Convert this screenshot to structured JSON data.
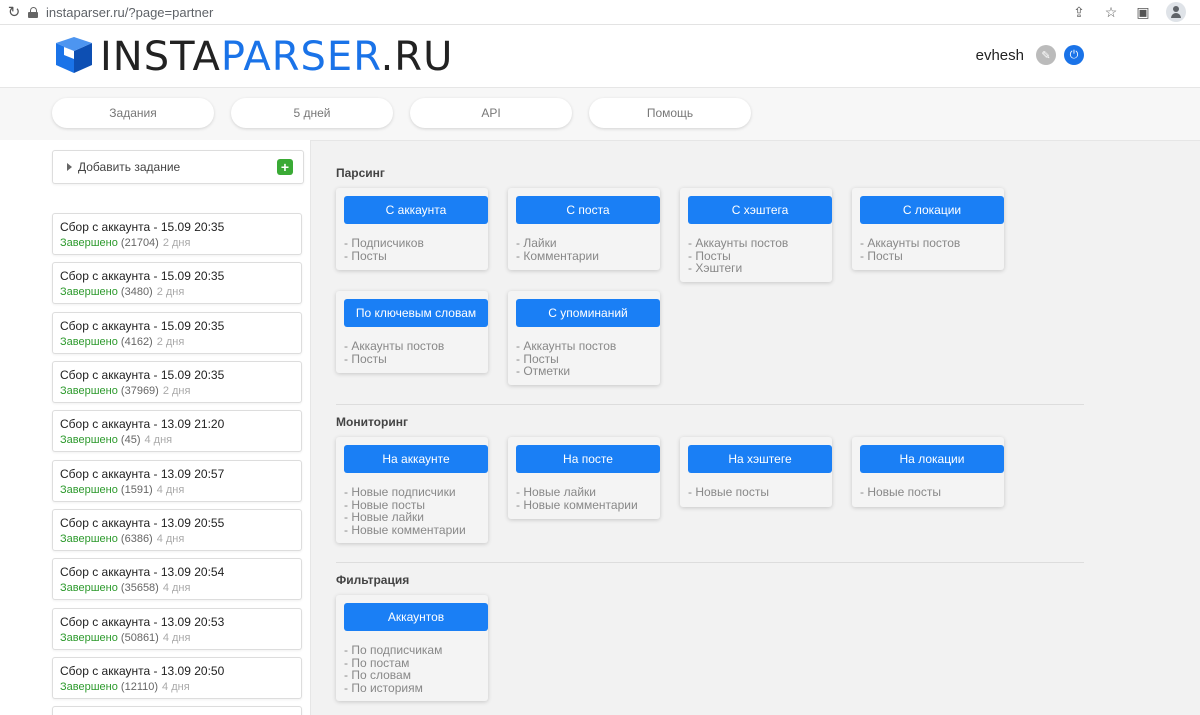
{
  "browser": {
    "url": "instaparser.ru/?page=partner"
  },
  "header": {
    "logo_part1": "INSTA",
    "logo_part2": "PARSER",
    "logo_part3": ".RU",
    "username": "evhesh"
  },
  "nav": {
    "tabs": [
      "Задания",
      "5 дней",
      "API",
      "Помощь"
    ]
  },
  "sidebar": {
    "add_task_label": "Добавить задание",
    "tasks": [
      {
        "title": "Сбор с аккаунта - 15.09 20:35",
        "status": "Завершено",
        "count": "(21704)",
        "age": "2 дня"
      },
      {
        "title": "Сбор с аккаунта - 15.09 20:35",
        "status": "Завершено",
        "count": "(3480)",
        "age": "2 дня"
      },
      {
        "title": "Сбор с аккаунта - 15.09 20:35",
        "status": "Завершено",
        "count": "(4162)",
        "age": "2 дня"
      },
      {
        "title": "Сбор с аккаунта - 15.09 20:35",
        "status": "Завершено",
        "count": "(37969)",
        "age": "2 дня"
      },
      {
        "title": "Сбор с аккаунта - 13.09 21:20",
        "status": "Завершено",
        "count": "(45)",
        "age": "4 дня"
      },
      {
        "title": "Сбор с аккаунта - 13.09 20:57",
        "status": "Завершено",
        "count": "(1591)",
        "age": "4 дня"
      },
      {
        "title": "Сбор с аккаунта - 13.09 20:55",
        "status": "Завершено",
        "count": "(6386)",
        "age": "4 дня"
      },
      {
        "title": "Сбор с аккаунта - 13.09 20:54",
        "status": "Завершено",
        "count": "(35658)",
        "age": "4 дня"
      },
      {
        "title": "Сбор с аккаунта - 13.09 20:53",
        "status": "Завершено",
        "count": "(50861)",
        "age": "4 дня"
      },
      {
        "title": "Сбор с аккаунта - 13.09 20:50",
        "status": "Завершено",
        "count": "(12110)",
        "age": "4 дня"
      }
    ]
  },
  "sections": {
    "parsing": {
      "title": "Парсинг",
      "cards": [
        {
          "button": "С аккаунта",
          "items": [
            "- Подписчиков",
            "- Посты"
          ]
        },
        {
          "button": "С поста",
          "items": [
            "- Лайки",
            "- Комментарии"
          ]
        },
        {
          "button": "С хэштега",
          "items": [
            "- Аккаунты постов",
            "- Посты",
            "- Хэштеги"
          ]
        },
        {
          "button": "С локации",
          "items": [
            "- Аккаунты постов",
            "- Посты"
          ]
        },
        {
          "button": "По ключевым словам",
          "items": [
            "- Аккаунты постов",
            "- Посты"
          ]
        },
        {
          "button": "С упоминаний",
          "items": [
            "- Аккаунты постов",
            "- Посты",
            "- Отметки"
          ]
        }
      ]
    },
    "monitoring": {
      "title": "Мониторинг",
      "cards": [
        {
          "button": "На аккаунте",
          "items": [
            "- Новые подписчики",
            "- Новые посты",
            "- Новые лайки",
            "- Новые комментарии"
          ]
        },
        {
          "button": "На посте",
          "items": [
            "- Новые лайки",
            "- Новые комментарии"
          ]
        },
        {
          "button": "На хэштеге",
          "items": [
            "- Новые посты"
          ]
        },
        {
          "button": "На локации",
          "items": [
            "- Новые посты"
          ]
        }
      ]
    },
    "filtering": {
      "title": "Фильтрация",
      "cards": [
        {
          "button": "Аккаунтов",
          "items": [
            "- По подписчикам",
            "- По постам",
            "- По словам",
            "- По историям"
          ]
        }
      ]
    }
  },
  "colors": {
    "accent": "#1a7ff5",
    "done": "#2d9a2d"
  }
}
